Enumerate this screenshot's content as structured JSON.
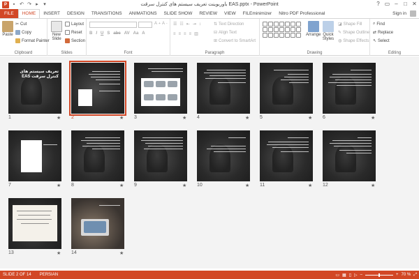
{
  "window": {
    "app_icon": "P",
    "title": "باوربوینت تعریف سیستم های کنترل سرقت EAS.pptx - PowerPoint",
    "controls": [
      "?",
      "▭",
      "–",
      "□",
      "✕"
    ]
  },
  "tabs": [
    "FILE",
    "HOME",
    "INSERT",
    "DESIGN",
    "TRANSITIONS",
    "ANIMATIONS",
    "SLIDE SHOW",
    "REVIEW",
    "VIEW",
    "FILEminimizer",
    "Nitro PDF Professional"
  ],
  "active_tab": "HOME",
  "account": {
    "sign_in": "Sign in"
  },
  "ribbon": {
    "clipboard": {
      "label": "Clipboard",
      "paste": "Paste",
      "cut": "Cut",
      "copy": "Copy",
      "format_painter": "Format Painter"
    },
    "slides": {
      "label": "Slides",
      "new_slide": "New Slide",
      "layout": "Layout",
      "reset": "Reset",
      "section": "Section"
    },
    "font": {
      "label": "Font"
    },
    "paragraph": {
      "label": "Paragraph",
      "text_direction": "Text Direction",
      "align_text": "Align Text",
      "convert_smartart": "Convert to SmartArt"
    },
    "drawing": {
      "label": "Drawing",
      "arrange": "Arrange",
      "quick_styles": "Quick Styles",
      "shape_fill": "Shape Fill",
      "shape_outline": "Shape Outline",
      "shape_effects": "Shape Effects"
    },
    "editing": {
      "label": "Editing",
      "find": "Find",
      "replace": "Replace",
      "select": "Select"
    }
  },
  "slides": [
    {
      "num": "1",
      "title": "تعریف سیستم های کنترل سرقت EAS"
    },
    {
      "num": "2"
    },
    {
      "num": "3"
    },
    {
      "num": "4"
    },
    {
      "num": "5"
    },
    {
      "num": "6"
    },
    {
      "num": "7"
    },
    {
      "num": "8"
    },
    {
      "num": "9"
    },
    {
      "num": "10"
    },
    {
      "num": "11"
    },
    {
      "num": "12"
    },
    {
      "num": "13"
    },
    {
      "num": "14"
    }
  ],
  "selected_slide": "2",
  "status": {
    "slide_info": "SLIDE 2 OF 14",
    "language": "PERSIAN",
    "zoom": "70 %",
    "zoom_minus": "–",
    "zoom_plus": "+"
  },
  "colors": {
    "accent": "#d24726",
    "sorter_bg": "#f3f3f3"
  }
}
